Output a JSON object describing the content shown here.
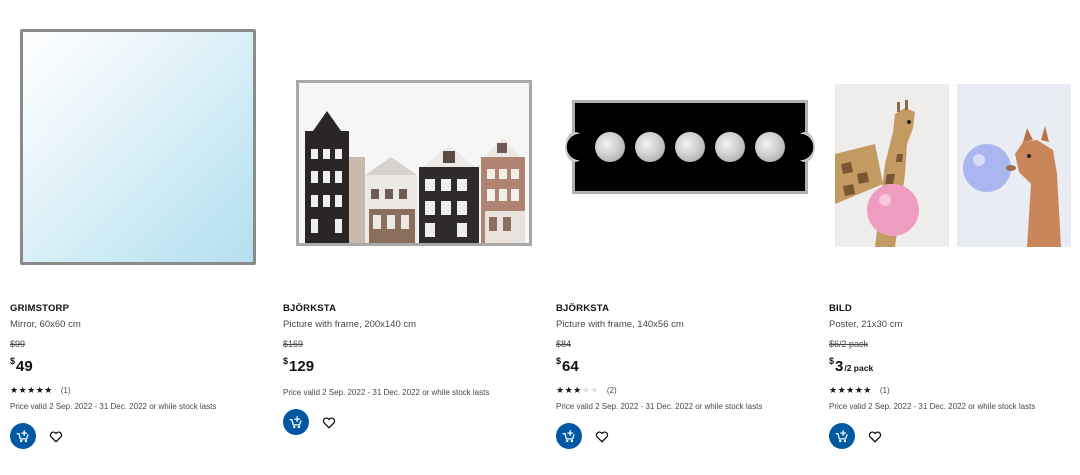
{
  "colors": {
    "accent": "#0058a3",
    "text": "#111111",
    "muted": "#484848"
  },
  "products": [
    {
      "name": "GRIMSTORP",
      "description": "Mirror, 60x60 cm",
      "old_price": "$99",
      "currency": "$",
      "price": "49",
      "unit": "",
      "stars": "★★★★★",
      "stars_empty": "",
      "rating": 5,
      "rating_count": "(1)",
      "validity": "Price valid 2 Sep. 2022 - 31 Dec. 2022 or while stock lasts",
      "image": "square mirror with light blue glass",
      "cart_icon": "add-to-cart-icon",
      "fav_icon": "heart-icon"
    },
    {
      "name": "BJÖRKSTA",
      "description": "Picture with frame, 200x140 cm",
      "old_price": "$169",
      "currency": "$",
      "price": "129",
      "unit": "",
      "stars": "",
      "stars_empty": "",
      "rating": null,
      "rating_count": "",
      "validity": "Price valid 2 Sep. 2022 - 31 Dec. 2022 or while stock lasts",
      "image": "framed picture of canal houses",
      "cart_icon": "add-to-cart-icon",
      "fav_icon": "heart-icon"
    },
    {
      "name": "BJÖRKSTA",
      "description": "Picture with frame, 140x56 cm",
      "old_price": "$84",
      "currency": "$",
      "price": "64",
      "unit": "",
      "stars": "★★★",
      "stars_empty": "★★",
      "rating": 3,
      "rating_count": "(2)",
      "validity": "Price valid 2 Sep. 2022 - 31 Dec. 2022 or while stock lasts",
      "image": "framed picture of moon phases",
      "cart_icon": "add-to-cart-icon",
      "fav_icon": "heart-icon"
    },
    {
      "name": "BILD",
      "description": "Poster, 21x30 cm",
      "old_price": "$6/2 pack",
      "currency": "$",
      "price": "3",
      "unit": "/2 pack",
      "stars": "★★★★★",
      "stars_empty": "",
      "rating": 5,
      "rating_count": "(1)",
      "validity": "Price valid 2 Sep. 2022 - 31 Dec. 2022 or while stock lasts",
      "image": "two posters: giraffe and alpaca blowing bubble gum",
      "cart_icon": "add-to-cart-icon",
      "fav_icon": "heart-icon"
    }
  ]
}
